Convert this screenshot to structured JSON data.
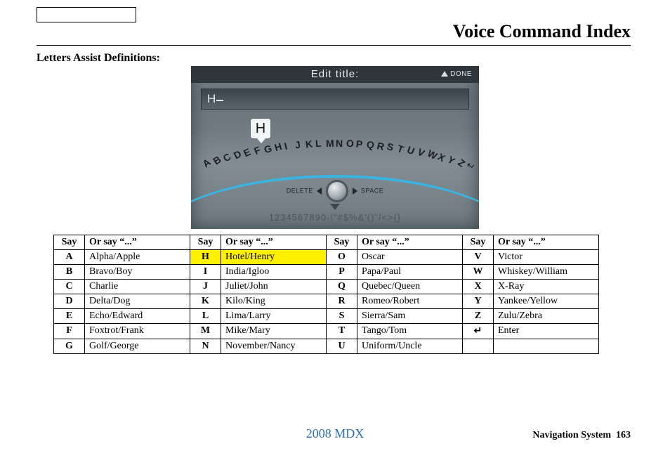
{
  "page_title": "Voice Command Index",
  "section_heading": "Letters Assist Definitions:",
  "nav_screen": {
    "edit_label": "Edit title:",
    "done_label": "DONE",
    "input_value": "H",
    "selected_key": "H",
    "arc_letters": [
      "A",
      "B",
      "C",
      "D",
      "E",
      "F",
      "G",
      "H",
      "I",
      "J",
      "K",
      "L",
      "M",
      "N",
      "O",
      "P",
      "Q",
      "R",
      "S",
      "T",
      "U",
      "V",
      "W",
      "X",
      "Y",
      "Z"
    ],
    "delete_label": "DELETE",
    "space_label": "SPACE",
    "numsym_row": "1234567890-!\"#$%&'()˜/<>{}"
  },
  "table": {
    "headers": {
      "say": "Say",
      "or_say": "Or say “...”"
    },
    "columns": [
      [
        {
          "say": "A",
          "or": "Alpha/Apple"
        },
        {
          "say": "B",
          "or": "Bravo/Boy"
        },
        {
          "say": "C",
          "or": "Charlie"
        },
        {
          "say": "D",
          "or": "Delta/Dog"
        },
        {
          "say": "E",
          "or": "Echo/Edward"
        },
        {
          "say": "F",
          "or": "Foxtrot/Frank"
        },
        {
          "say": "G",
          "or": "Golf/George"
        }
      ],
      [
        {
          "say": "H",
          "or": "Hotel/Henry",
          "highlight": true
        },
        {
          "say": "I",
          "or": "India/Igloo"
        },
        {
          "say": "J",
          "or": "Juliet/John"
        },
        {
          "say": "K",
          "or": "Kilo/King"
        },
        {
          "say": "L",
          "or": "Lima/Larry"
        },
        {
          "say": "M",
          "or": "Mike/Mary"
        },
        {
          "say": "N",
          "or": "November/Nancy"
        }
      ],
      [
        {
          "say": "O",
          "or": "Oscar"
        },
        {
          "say": "P",
          "or": "Papa/Paul"
        },
        {
          "say": "Q",
          "or": "Quebec/Queen"
        },
        {
          "say": "R",
          "or": "Romeo/Robert"
        },
        {
          "say": "S",
          "or": "Sierra/Sam"
        },
        {
          "say": "T",
          "or": "Tango/Tom"
        },
        {
          "say": "U",
          "or": "Uniform/Uncle"
        }
      ],
      [
        {
          "say": "V",
          "or": "Victor"
        },
        {
          "say": "W",
          "or": "Whiskey/William"
        },
        {
          "say": "X",
          "or": "X-Ray"
        },
        {
          "say": "Y",
          "or": "Yankee/Yellow"
        },
        {
          "say": "Z",
          "or": "Zulu/Zebra"
        },
        {
          "say": "↵",
          "or": "Enter",
          "icon": true
        }
      ]
    ]
  },
  "footer": {
    "model": "2008  MDX",
    "section": "Navigation System",
    "page": "163"
  }
}
